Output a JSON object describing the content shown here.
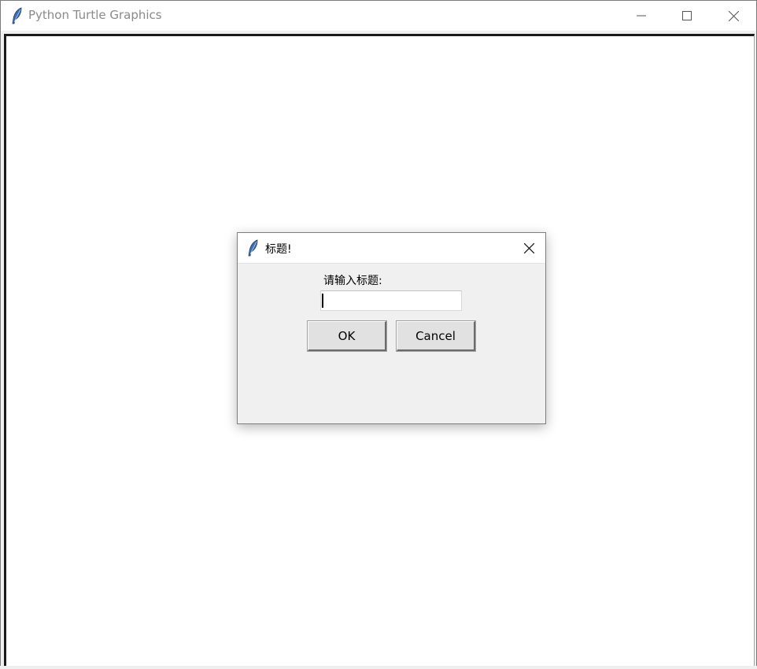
{
  "window": {
    "title": "Python Turtle Graphics",
    "icon": "feather-icon",
    "controls": {
      "minimize": "minimize-icon",
      "maximize": "maximize-icon",
      "close": "close-icon"
    }
  },
  "canvas": {
    "background": "#ffffff"
  },
  "dialog": {
    "title": "标题!",
    "icon": "feather-icon",
    "prompt": "请输入标题:",
    "input": {
      "value": "",
      "placeholder": ""
    },
    "buttons": {
      "ok_label": "OK",
      "cancel_label": "Cancel"
    }
  }
}
